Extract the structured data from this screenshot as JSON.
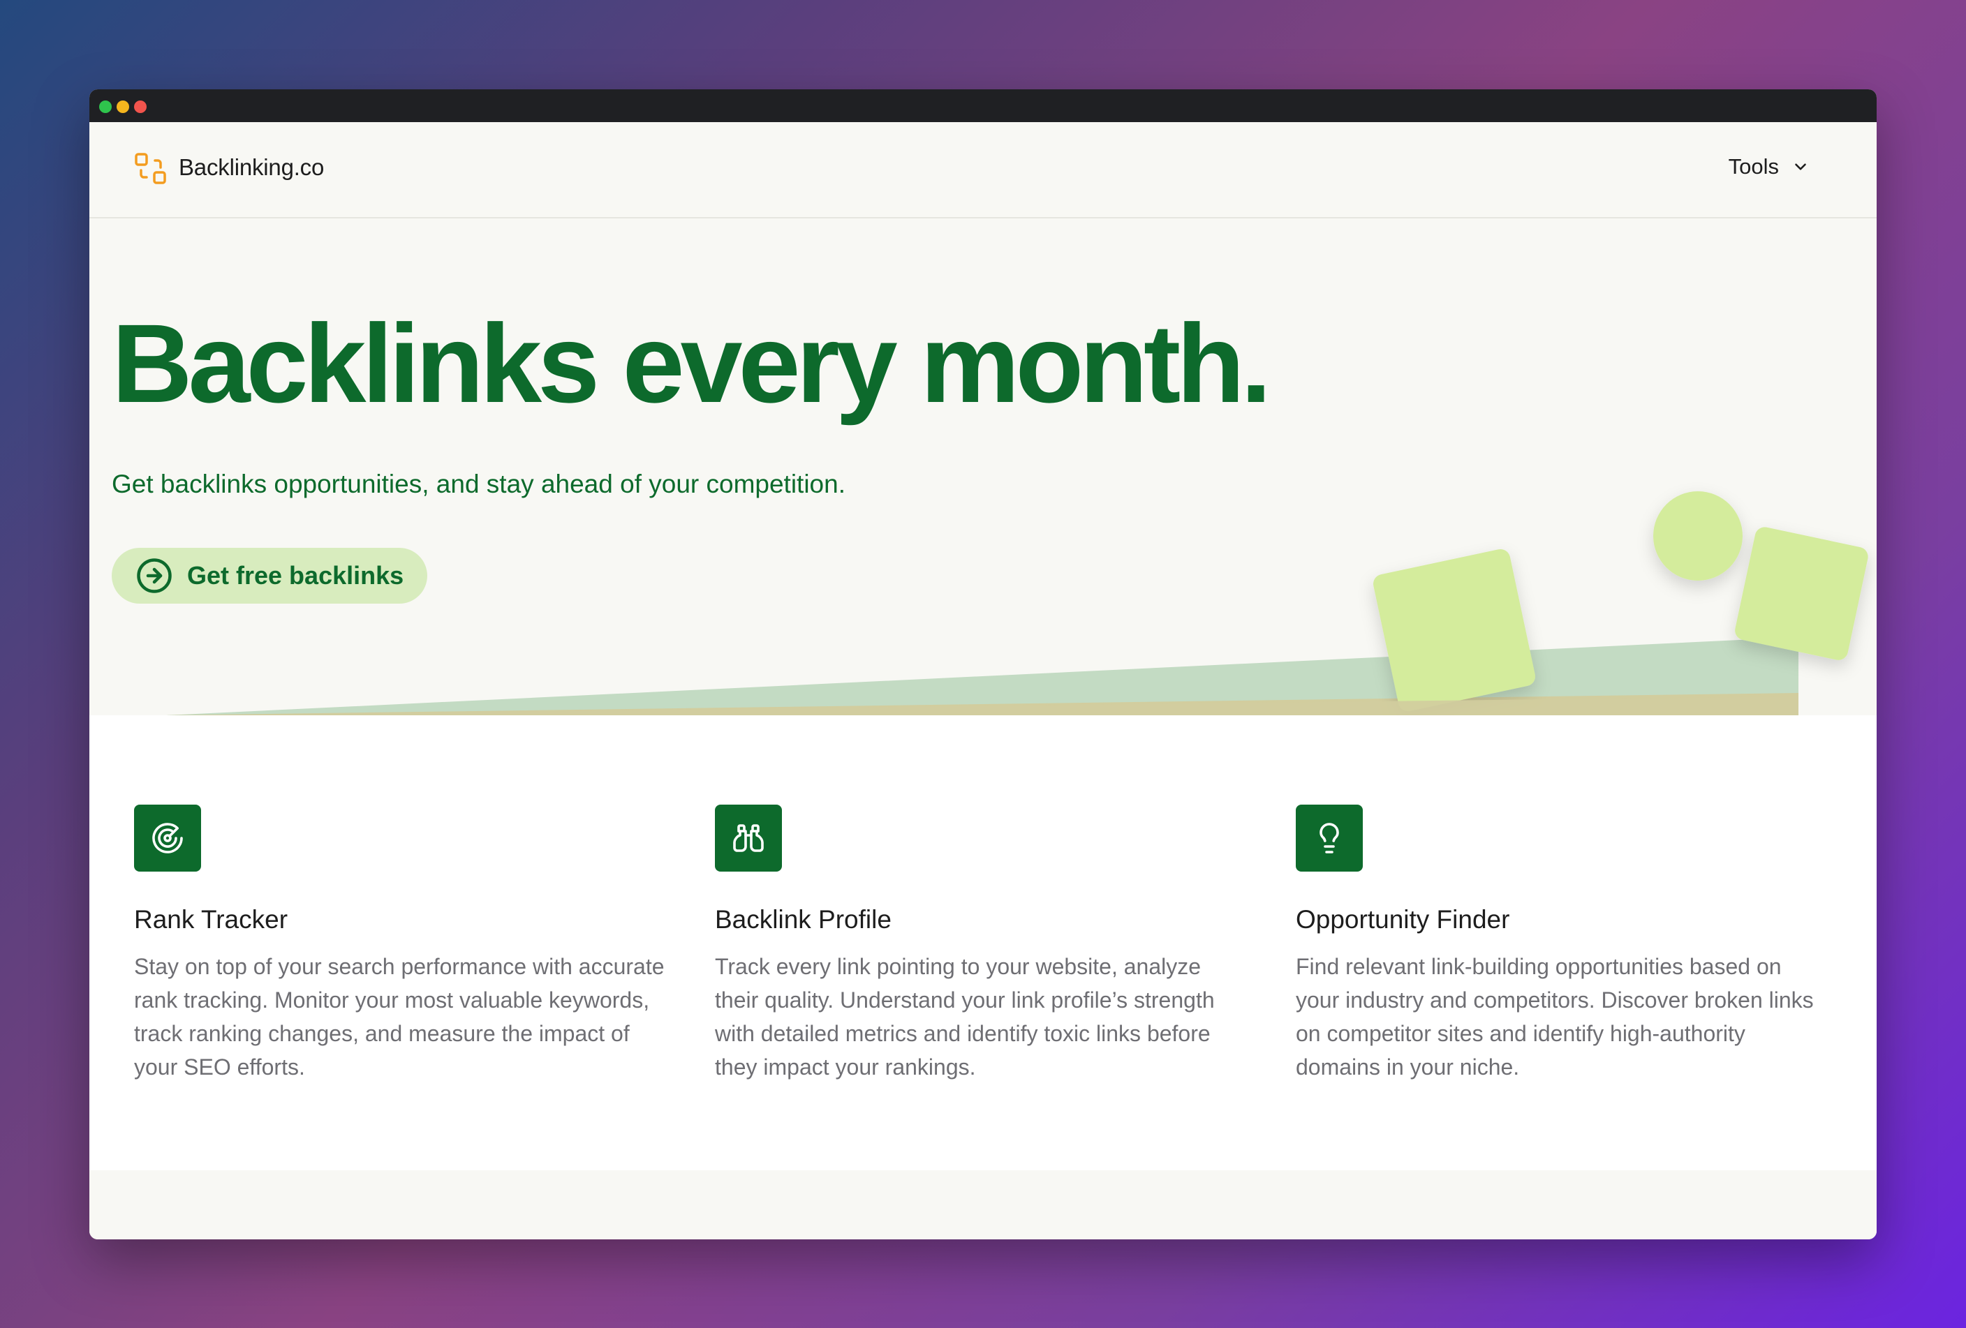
{
  "window": {
    "controls": [
      "green",
      "yellow",
      "red"
    ]
  },
  "nav": {
    "logo_text": "Backlinking.co",
    "logo_icon": "link-squares-icon",
    "tools_label": "Tools",
    "tools_icon": "chevron-down-icon"
  },
  "hero": {
    "title": "Backlinks every month.",
    "subtitle": "Get backlinks opportunities, and stay ahead of your competition.",
    "cta_label": "Get free backlinks",
    "cta_icon": "arrow-right-circle-icon"
  },
  "features": [
    {
      "icon": "radar-icon",
      "title": "Rank Tracker",
      "description": "Stay on top of your search performance with accurate rank tracking. Monitor your most valuable keywords, track ranking changes, and measure the impact of your SEO efforts."
    },
    {
      "icon": "binoculars-icon",
      "title": "Backlink Profile",
      "description": "Track every link pointing to your website, analyze their quality. Understand your link profile’s strength with detailed metrics and identify toxic links before they impact your rankings."
    },
    {
      "icon": "lightbulb-icon",
      "title": "Opportunity Finder",
      "description": "Find relevant link-building opportunities based on your industry and competitors. Discover broken links on competitor sites and identify high-authority domains in your niche."
    }
  ],
  "colors": {
    "brand_green": "#0d6a2c",
    "accent_lime": "#d8ecbe",
    "logo_orange": "#f39c1f",
    "hero_bg": "#f8f8f4"
  }
}
